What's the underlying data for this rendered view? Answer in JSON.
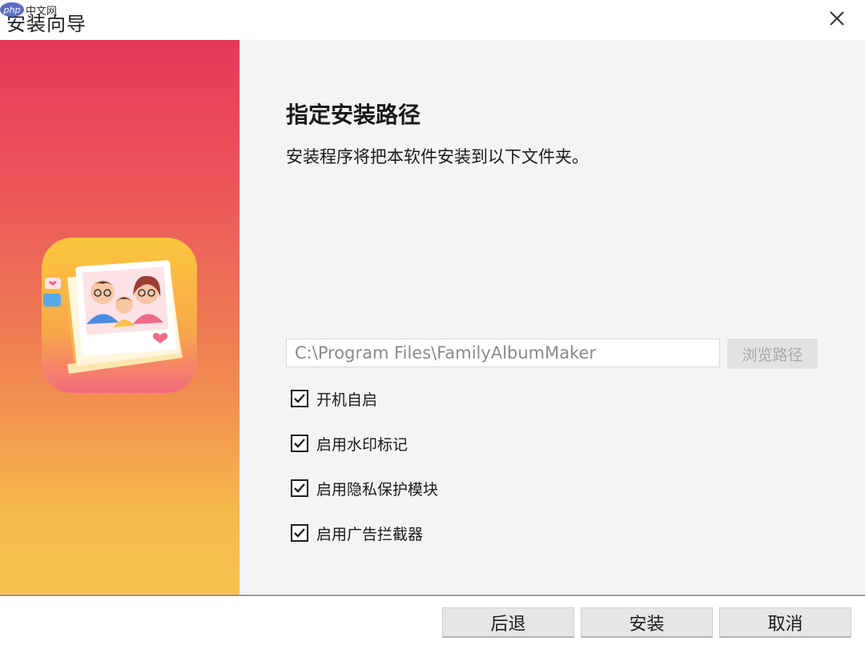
{
  "window": {
    "title": "安装向导",
    "watermark_logo": "php",
    "watermark_text": "中文网",
    "close_icon": "close-icon"
  },
  "banner": {
    "icon": "family-album-app-icon",
    "colors": {
      "top": "#e8375a",
      "bottom": "#f9c24c"
    }
  },
  "content": {
    "heading": "指定安装路径",
    "description": "安装程序将把本软件安装到以下文件夹。",
    "install_path": "C:\\Program Files\\FamilyAlbumMaker",
    "browse_label": "浏览路径"
  },
  "options": [
    {
      "label": "开机自启",
      "checked": true
    },
    {
      "label": "启用水印标记",
      "checked": true
    },
    {
      "label": "启用隐私保护模块",
      "checked": true
    },
    {
      "label": "启用广告拦截器",
      "checked": true
    }
  ],
  "footer": {
    "back_label": "后退",
    "install_label": "安装",
    "cancel_label": "取消"
  }
}
